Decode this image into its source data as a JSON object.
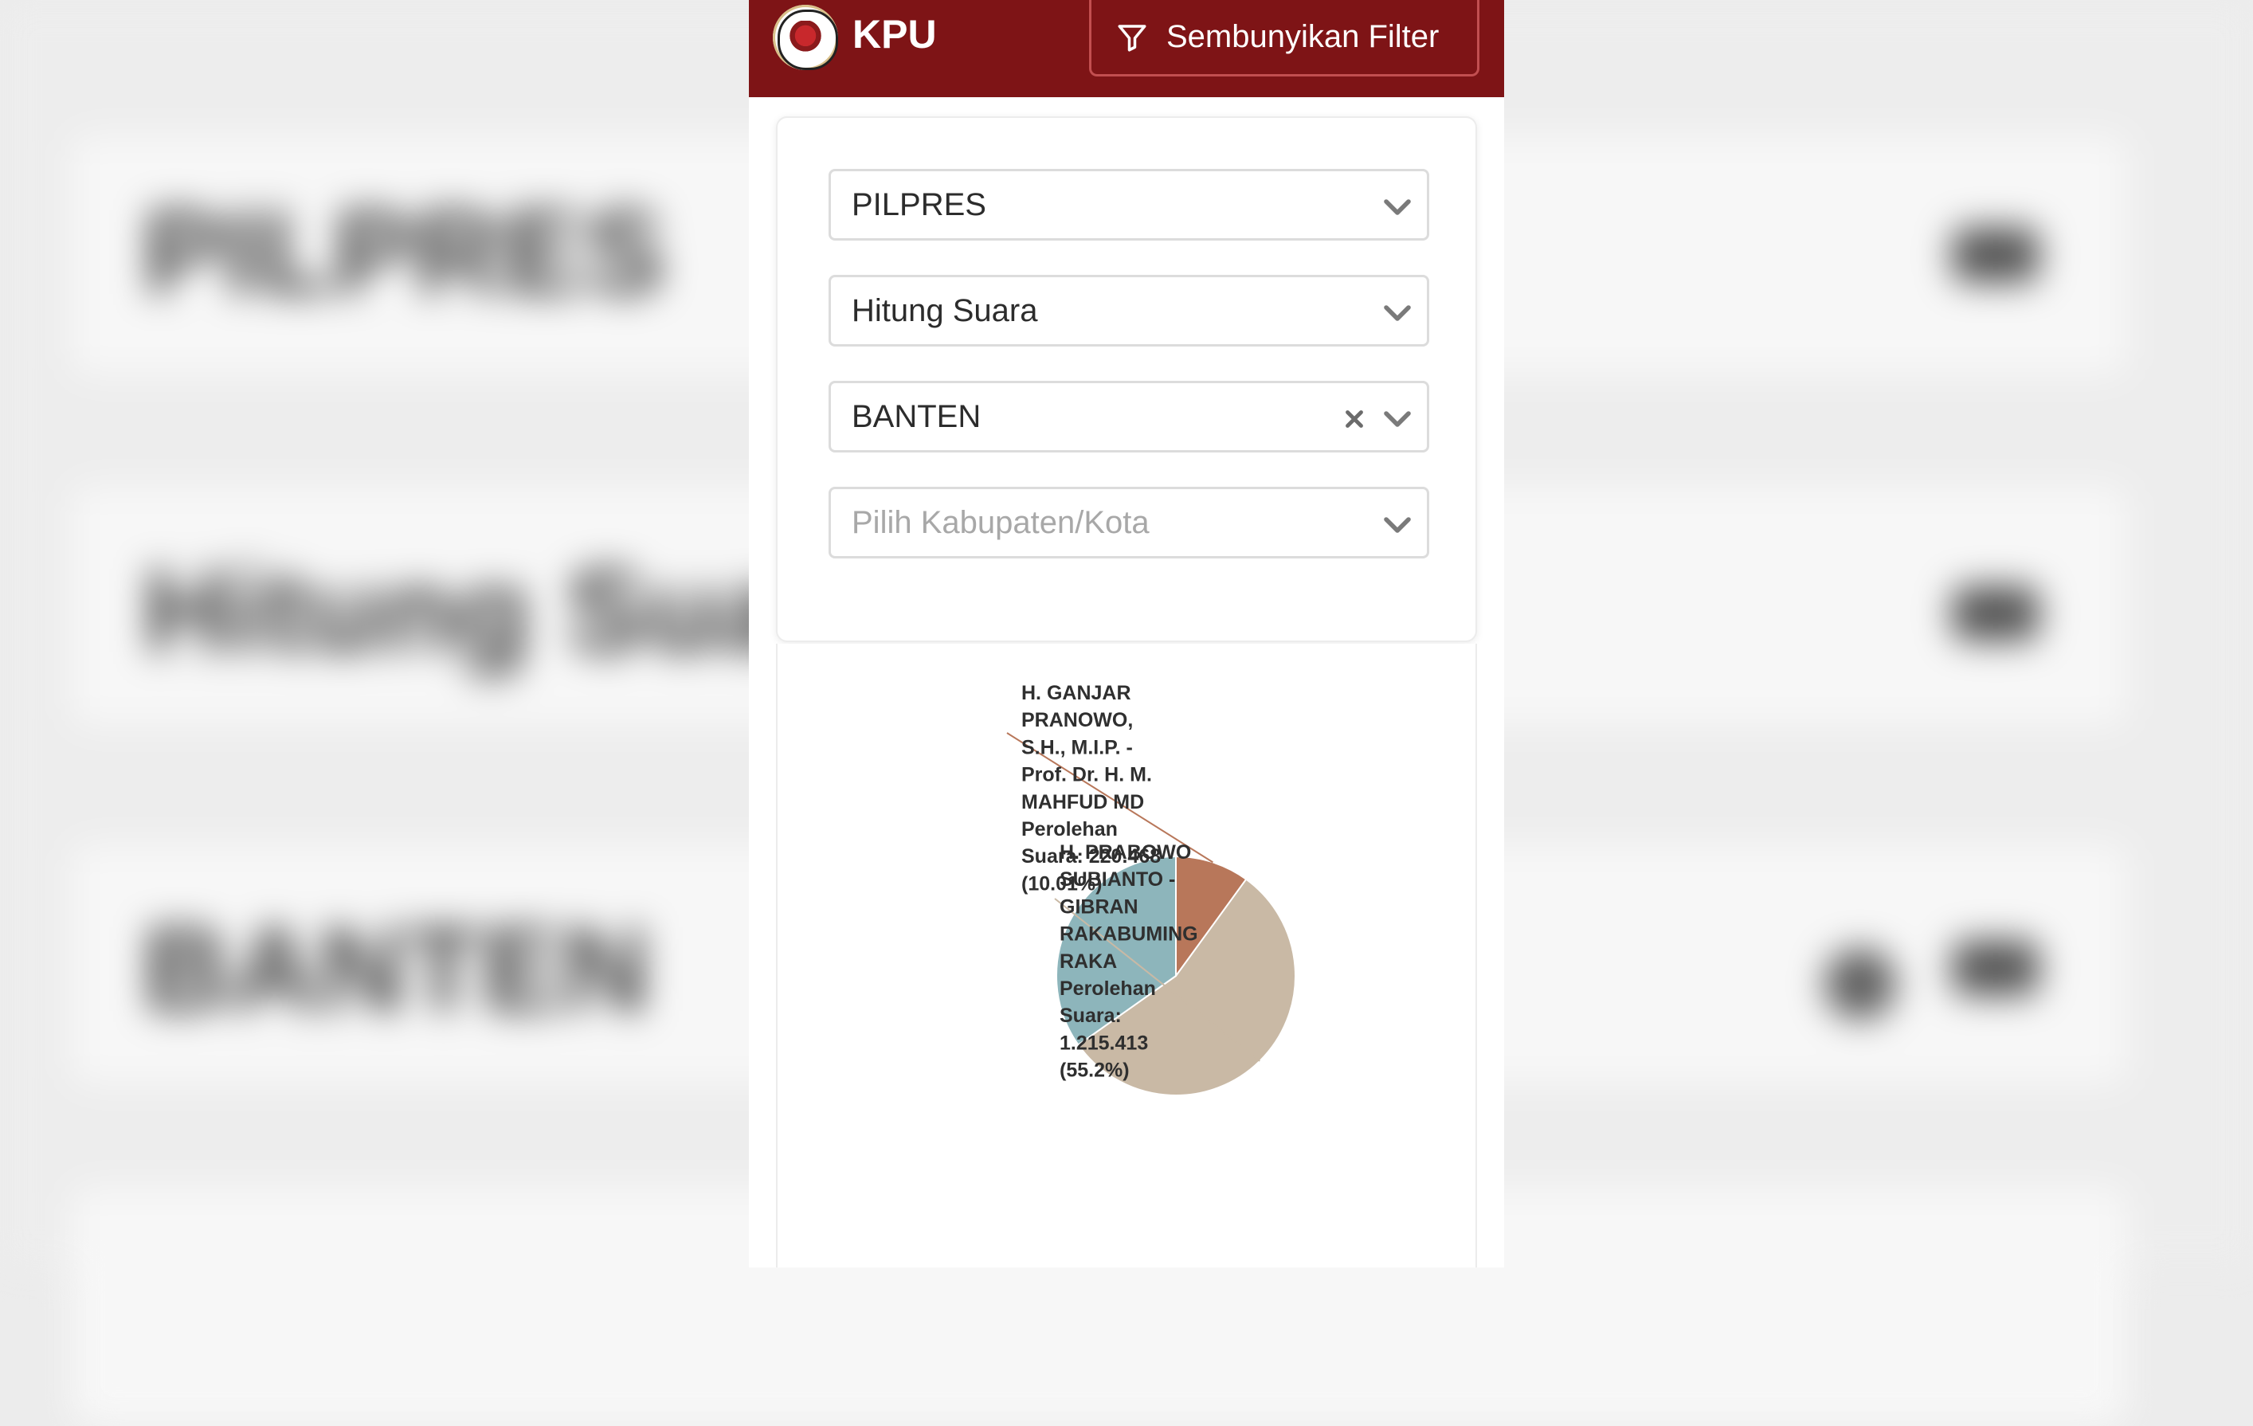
{
  "header": {
    "brand": "KPU",
    "filter_button_label": "Sembunyikan Filter"
  },
  "filters": [
    {
      "name": "election-type-select",
      "value": "PILPRES",
      "placeholder": "",
      "clearable": false
    },
    {
      "name": "data-type-select",
      "value": "Hitung Suara",
      "placeholder": "",
      "clearable": false
    },
    {
      "name": "province-select",
      "value": "BANTEN",
      "placeholder": "",
      "clearable": true
    },
    {
      "name": "regency-select",
      "value": "",
      "placeholder": "Pilih Kabupaten/Kota",
      "clearable": false
    }
  ],
  "background_echo": {
    "line1": "PILPRES",
    "line2": "Hitung Suara",
    "line3": "BANTEN"
  },
  "chart_data": {
    "type": "pie",
    "slices": [
      {
        "name": "H. GANJAR PRANOWO, S.H., M.I.P. - Prof. Dr. H. M. MAHFUD MD",
        "votes_text": "220.468",
        "votes": 220468,
        "percent": 10.01,
        "color": "#b8775a",
        "label_lines": [
          "H. GANJAR",
          "PRANOWO,",
          "S.H., M.I.P. -",
          "Prof. Dr. H. M.",
          "MAHFUD MD",
          "Perolehan",
          "Suara: 220.468",
          "(10.01%)"
        ]
      },
      {
        "name": "H. PRABOWO SUBIANTO - GIBRAN RAKABUMING RAKA",
        "votes_text": "1.215.413",
        "votes": 1215413,
        "percent": 55.2,
        "color": "#c9b9a5",
        "label_lines": [
          "H. PRABOWO",
          "SUBIANTO -",
          "GIBRAN",
          "RAKABUMING",
          "RAKA",
          "Perolehan",
          "Suara:",
          "1.215.413",
          "(55.2%)"
        ]
      },
      {
        "name": "",
        "votes_text": "",
        "votes": null,
        "percent": 34.79,
        "color": "#8db5bb",
        "label_lines": []
      }
    ]
  },
  "colors": {
    "topbar": "#7e1416",
    "accent_border": "#c24f50"
  }
}
